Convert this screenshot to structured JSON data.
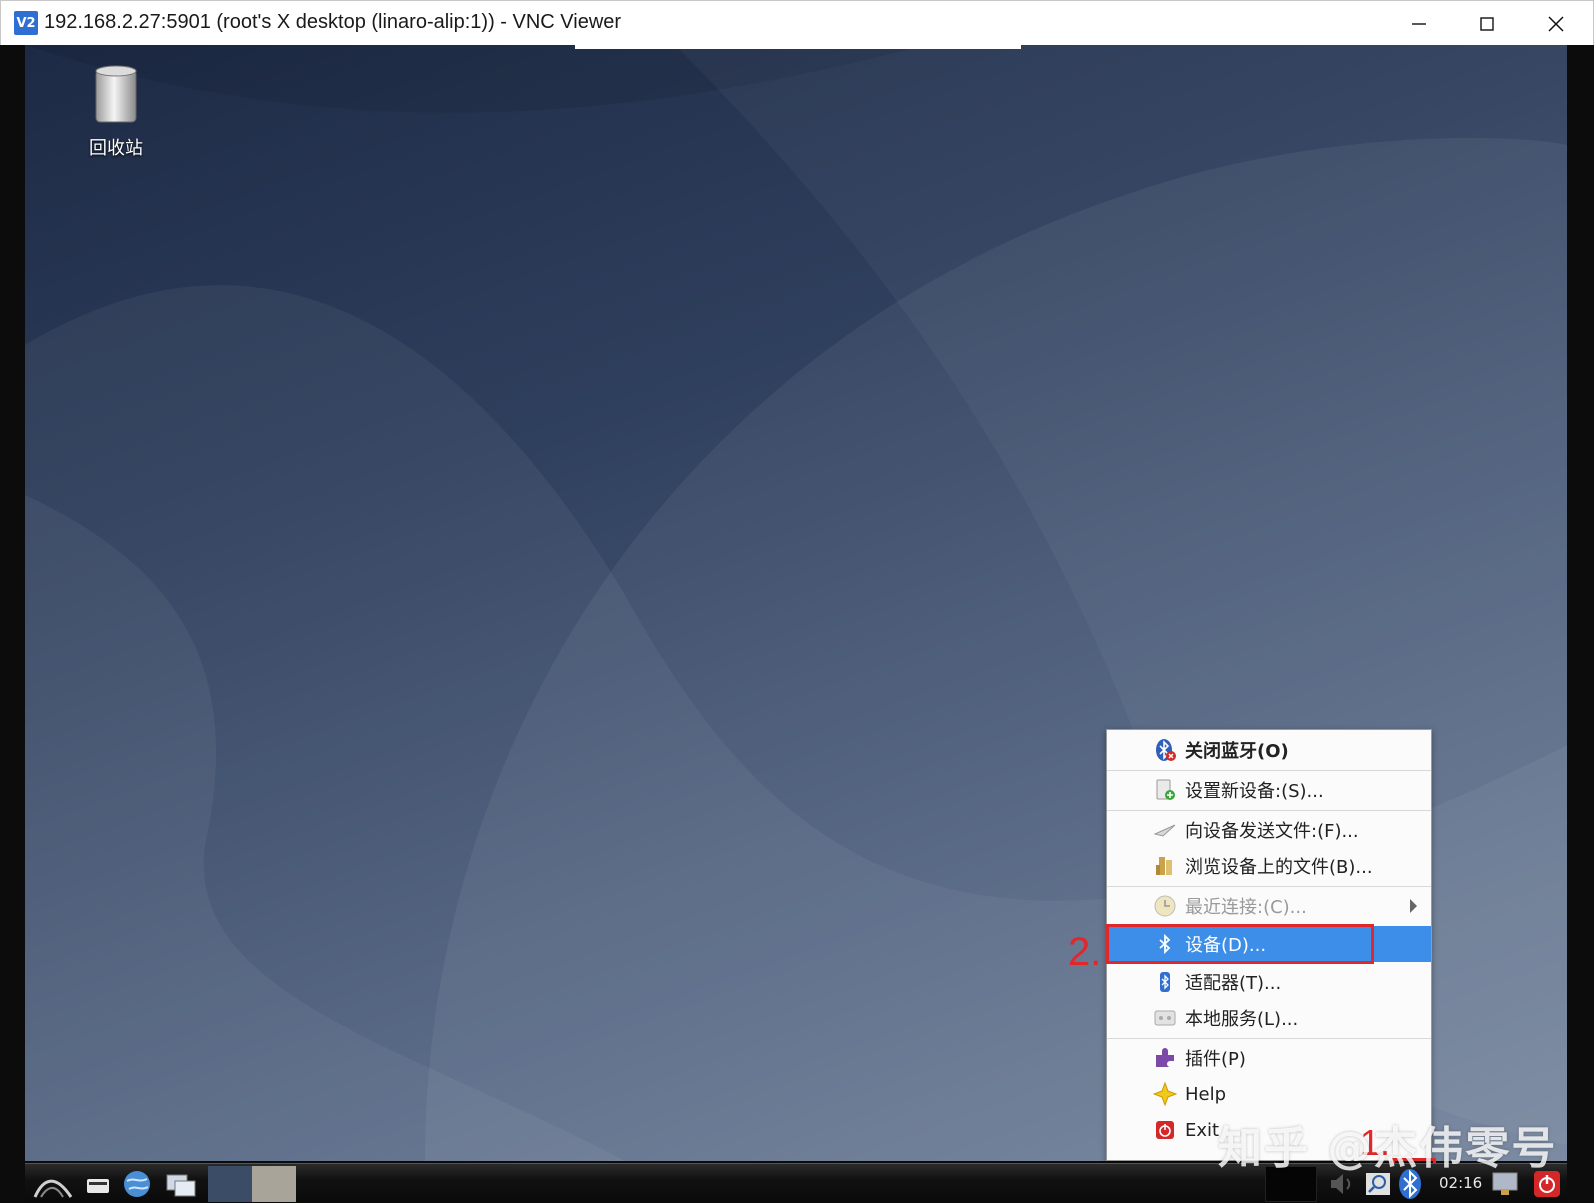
{
  "window": {
    "title": "192.168.2.27:5901 (root's X desktop (linaro-alip:1)) - VNC Viewer",
    "app_icon_text": "V2",
    "controls": {
      "minimize": "minimize-icon",
      "maximize": "maximize-icon",
      "close": "close-icon"
    }
  },
  "desktop": {
    "icons": [
      {
        "label": "回收站",
        "icon": "trash-icon"
      }
    ]
  },
  "context_menu": {
    "items": [
      {
        "label": "关闭蓝牙(O)",
        "icon": "bluetooth-off-icon",
        "style": "bold"
      },
      {
        "label": "设置新设备:(S)...",
        "icon": "new-device-icon"
      },
      {
        "label": "向设备发送文件:(F)...",
        "icon": "send-file-icon"
      },
      {
        "label": "浏览设备上的文件(B)...",
        "icon": "browse-files-icon"
      },
      {
        "label": "最近连接:(C)...",
        "icon": "recent-icon",
        "state": "disabled",
        "submenu": true
      },
      {
        "label": "设备(D)...",
        "icon": "bluetooth-icon",
        "state": "highlighted"
      },
      {
        "label": "适配器(T)...",
        "icon": "adapter-icon"
      },
      {
        "label": "本地服务(L)...",
        "icon": "local-services-icon"
      },
      {
        "label": "插件(P)",
        "icon": "plugin-icon"
      },
      {
        "label": "Help",
        "icon": "help-icon"
      },
      {
        "label": "Exit",
        "icon": "exit-icon"
      }
    ]
  },
  "annotations": {
    "step1": "1.",
    "step2": "2.",
    "color": "#e0282a"
  },
  "taskbar": {
    "clock": "02:16",
    "tray_icons": [
      "volume-icon",
      "search-icon",
      "bluetooth-tray-icon",
      "network-icon",
      "power-icon"
    ],
    "launchers": [
      "menu-logo-icon",
      "terminal-icon",
      "browser-icon",
      "desktop-switch-icon"
    ]
  },
  "watermark": "知乎 @杰伟零号",
  "colors": {
    "menu_highlight": "#3d8ee8",
    "desktop_dark": "#1d2a45",
    "desktop_light": "#6d7e98"
  }
}
